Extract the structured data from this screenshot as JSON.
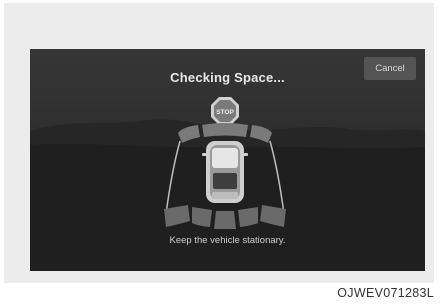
{
  "dialog": {
    "title": "Checking Space...",
    "cancel_label": "Cancel",
    "instruction": "Keep the vehicle stationary.",
    "stop_sign_text": "STOP"
  },
  "figure_code": "OJWEV071283L",
  "colors": {
    "screen_bg": "#2b2b2b",
    "button_bg": "#545454",
    "sensor_zone": "#6e6e6e",
    "text": "#e8e8e8"
  }
}
